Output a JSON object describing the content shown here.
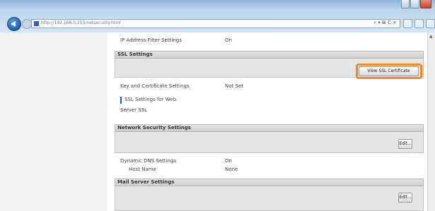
{
  "browser": {
    "url": "http://192.168.0.215/netsecurity.html",
    "search_tools": "⌕ ▾ ⊠ C ×",
    "window_controls": [
      "minimize",
      "maximize",
      "close"
    ],
    "toolbar_icons": [
      "home-icon",
      "favorites-icon",
      "tools-icon"
    ]
  },
  "page": {
    "top_row": {
      "label": "IP Address Filter Settings",
      "value": "On"
    },
    "ssl_section": {
      "header": "SSL Settings",
      "view_button": "View SSL Certificate"
    },
    "key_row": {
      "label": "Key and Certificate Settings",
      "value": "Not Set"
    },
    "security_item": "SSL Settings for Web",
    "server_row": "Server SSL",
    "netsec_section": {
      "header": "Network Security Settings",
      "edit_button": "Edit..."
    },
    "dns_row": {
      "label": "Dynamic DNS Settings",
      "value": "On"
    },
    "host_row": {
      "label": "Host Name",
      "value": "None"
    },
    "mail_section": {
      "header": "Mail Server Settings",
      "edit_button": "Edit..."
    }
  },
  "colors": {
    "focus_highlight": "#f08c1e",
    "chrome_top": "#8fb7dc",
    "section_header": "#d8d8d8"
  }
}
